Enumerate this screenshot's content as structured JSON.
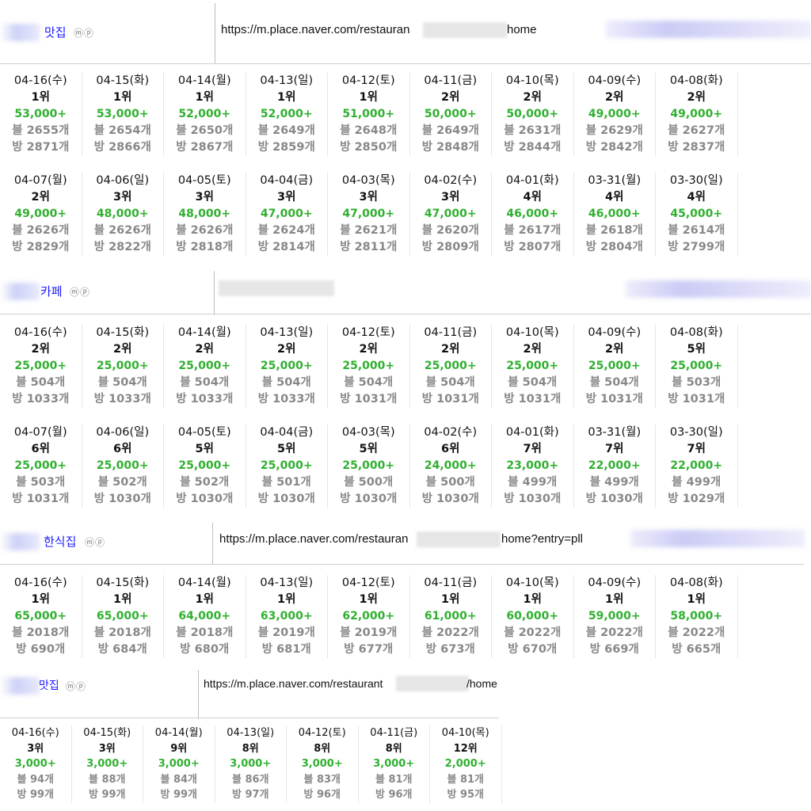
{
  "sections": [
    {
      "name": "맛집",
      "mp": "ⓜⓟ",
      "url_prefix": "https://m.place.naver.com/restauran",
      "url_suffix": "home",
      "rows": [
        [
          {
            "date": "04-16(수)",
            "rank": "1위",
            "count": "53,000+",
            "blog": "블 2655개",
            "bang": "방 2871개"
          },
          {
            "date": "04-15(화)",
            "rank": "1위",
            "count": "53,000+",
            "blog": "블 2654개",
            "bang": "방 2866개"
          },
          {
            "date": "04-14(월)",
            "rank": "1위",
            "count": "52,000+",
            "blog": "블 2650개",
            "bang": "방 2867개"
          },
          {
            "date": "04-13(일)",
            "rank": "1위",
            "count": "52,000+",
            "blog": "블 2649개",
            "bang": "방 2859개"
          },
          {
            "date": "04-12(토)",
            "rank": "1위",
            "count": "51,000+",
            "blog": "블 2648개",
            "bang": "방 2850개"
          },
          {
            "date": "04-11(금)",
            "rank": "2위",
            "count": "50,000+",
            "blog": "블 2649개",
            "bang": "방 2848개"
          },
          {
            "date": "04-10(목)",
            "rank": "2위",
            "count": "50,000+",
            "blog": "블 2631개",
            "bang": "방 2844개"
          },
          {
            "date": "04-09(수)",
            "rank": "2위",
            "count": "49,000+",
            "blog": "블 2629개",
            "bang": "방 2842개"
          },
          {
            "date": "04-08(화)",
            "rank": "2위",
            "count": "49,000+",
            "blog": "블 2627개",
            "bang": "방 2837개"
          }
        ],
        [
          {
            "date": "04-07(월)",
            "rank": "2위",
            "count": "49,000+",
            "blog": "블 2626개",
            "bang": "방 2829개"
          },
          {
            "date": "04-06(일)",
            "rank": "3위",
            "count": "48,000+",
            "blog": "블 2626개",
            "bang": "방 2822개"
          },
          {
            "date": "04-05(토)",
            "rank": "3위",
            "count": "48,000+",
            "blog": "블 2626개",
            "bang": "방 2818개"
          },
          {
            "date": "04-04(금)",
            "rank": "3위",
            "count": "47,000+",
            "blog": "블 2624개",
            "bang": "방 2814개"
          },
          {
            "date": "04-03(목)",
            "rank": "3위",
            "count": "47,000+",
            "blog": "블 2621개",
            "bang": "방 2811개"
          },
          {
            "date": "04-02(수)",
            "rank": "3위",
            "count": "47,000+",
            "blog": "블 2620개",
            "bang": "방 2809개"
          },
          {
            "date": "04-01(화)",
            "rank": "4위",
            "count": "46,000+",
            "blog": "블 2617개",
            "bang": "방 2807개"
          },
          {
            "date": "03-31(월)",
            "rank": "4위",
            "count": "46,000+",
            "blog": "블 2618개",
            "bang": "방 2804개"
          },
          {
            "date": "03-30(일)",
            "rank": "4위",
            "count": "45,000+",
            "blog": "블 2614개",
            "bang": "방 2799개"
          }
        ]
      ]
    },
    {
      "name": "카페",
      "mp": "ⓜⓟ",
      "url_prefix": "",
      "url_suffix": "",
      "rows": [
        [
          {
            "date": "04-16(수)",
            "rank": "2위",
            "count": "25,000+",
            "blog": "블 504개",
            "bang": "방 1033개"
          },
          {
            "date": "04-15(화)",
            "rank": "2위",
            "count": "25,000+",
            "blog": "블 504개",
            "bang": "방 1033개"
          },
          {
            "date": "04-14(월)",
            "rank": "2위",
            "count": "25,000+",
            "blog": "블 504개",
            "bang": "방 1033개"
          },
          {
            "date": "04-13(일)",
            "rank": "2위",
            "count": "25,000+",
            "blog": "블 504개",
            "bang": "방 1033개"
          },
          {
            "date": "04-12(토)",
            "rank": "2위",
            "count": "25,000+",
            "blog": "블 504개",
            "bang": "방 1031개"
          },
          {
            "date": "04-11(금)",
            "rank": "2위",
            "count": "25,000+",
            "blog": "블 504개",
            "bang": "방 1031개"
          },
          {
            "date": "04-10(목)",
            "rank": "2위",
            "count": "25,000+",
            "blog": "블 504개",
            "bang": "방 1031개"
          },
          {
            "date": "04-09(수)",
            "rank": "2위",
            "count": "25,000+",
            "blog": "블 504개",
            "bang": "방 1031개"
          },
          {
            "date": "04-08(화)",
            "rank": "5위",
            "count": "25,000+",
            "blog": "블 503개",
            "bang": "방 1031개"
          }
        ],
        [
          {
            "date": "04-07(월)",
            "rank": "6위",
            "count": "25,000+",
            "blog": "블 503개",
            "bang": "방 1031개"
          },
          {
            "date": "04-06(일)",
            "rank": "6위",
            "count": "25,000+",
            "blog": "블 502개",
            "bang": "방 1030개"
          },
          {
            "date": "04-05(토)",
            "rank": "5위",
            "count": "25,000+",
            "blog": "블 502개",
            "bang": "방 1030개"
          },
          {
            "date": "04-04(금)",
            "rank": "5위",
            "count": "25,000+",
            "blog": "블 501개",
            "bang": "방 1030개"
          },
          {
            "date": "04-03(목)",
            "rank": "5위",
            "count": "25,000+",
            "blog": "블 500개",
            "bang": "방 1030개"
          },
          {
            "date": "04-02(수)",
            "rank": "6위",
            "count": "24,000+",
            "blog": "블 500개",
            "bang": "방 1030개"
          },
          {
            "date": "04-01(화)",
            "rank": "7위",
            "count": "23,000+",
            "blog": "블 499개",
            "bang": "방 1030개"
          },
          {
            "date": "03-31(월)",
            "rank": "7위",
            "count": "22,000+",
            "blog": "블 499개",
            "bang": "방 1030개"
          },
          {
            "date": "03-30(일)",
            "rank": "7위",
            "count": "22,000+",
            "blog": "블 499개",
            "bang": "방 1029개"
          }
        ]
      ]
    },
    {
      "name": "한식집",
      "mp": "ⓜⓟ",
      "url_prefix": "https://m.place.naver.com/restauran",
      "url_suffix": "home?entry=pll",
      "rows": [
        [
          {
            "date": "04-16(수)",
            "rank": "1위",
            "count": "65,000+",
            "blog": "블 2018개",
            "bang": "방 690개"
          },
          {
            "date": "04-15(화)",
            "rank": "1위",
            "count": "65,000+",
            "blog": "블 2018개",
            "bang": "방 684개"
          },
          {
            "date": "04-14(월)",
            "rank": "1위",
            "count": "64,000+",
            "blog": "블 2018개",
            "bang": "방 680개"
          },
          {
            "date": "04-13(일)",
            "rank": "1위",
            "count": "63,000+",
            "blog": "블 2019개",
            "bang": "방 681개"
          },
          {
            "date": "04-12(토)",
            "rank": "1위",
            "count": "62,000+",
            "blog": "블 2019개",
            "bang": "방 677개"
          },
          {
            "date": "04-11(금)",
            "rank": "1위",
            "count": "61,000+",
            "blog": "블 2022개",
            "bang": "방 673개"
          },
          {
            "date": "04-10(목)",
            "rank": "1위",
            "count": "60,000+",
            "blog": "블 2022개",
            "bang": "방 670개"
          },
          {
            "date": "04-09(수)",
            "rank": "1위",
            "count": "59,000+",
            "blog": "블 2022개",
            "bang": "방 669개"
          },
          {
            "date": "04-08(화)",
            "rank": "1위",
            "count": "58,000+",
            "blog": "블 2022개",
            "bang": "방 665개"
          }
        ]
      ]
    },
    {
      "name": "맛집",
      "mp": "ⓜⓟ",
      "url_prefix": "https://m.place.naver.com/restaurant",
      "url_suffix": "/home",
      "rows": [
        [
          {
            "date": "04-16(수)",
            "rank": "3위",
            "count": "3,000+",
            "blog": "블 94개",
            "bang": "방 99개"
          },
          {
            "date": "04-15(화)",
            "rank": "3위",
            "count": "3,000+",
            "blog": "블 88개",
            "bang": "방 99개"
          },
          {
            "date": "04-14(월)",
            "rank": "9위",
            "count": "3,000+",
            "blog": "블 84개",
            "bang": "방 99개"
          },
          {
            "date": "04-13(일)",
            "rank": "8위",
            "count": "3,000+",
            "blog": "블 86개",
            "bang": "방 97개"
          },
          {
            "date": "04-12(토)",
            "rank": "8위",
            "count": "3,000+",
            "blog": "블 83개",
            "bang": "방 96개"
          },
          {
            "date": "04-11(금)",
            "rank": "8위",
            "count": "3,000+",
            "blog": "블 81개",
            "bang": "방 96개"
          },
          {
            "date": "04-10(목)",
            "rank": "12위",
            "count": "2,000+",
            "blog": "블 81개",
            "bang": "방 95개"
          }
        ]
      ]
    }
  ]
}
